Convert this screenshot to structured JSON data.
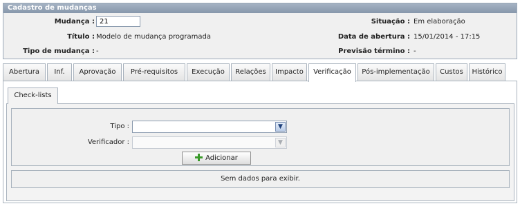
{
  "panel": {
    "title": "Cadastro de mudanças",
    "mudanca_label": "Mudança :",
    "mudanca_value": "21",
    "titulo_label": "Título :",
    "titulo_value": "Modelo de mudança programada",
    "tipo_label": "Tipo de mudança :",
    "tipo_value": "-",
    "situacao_label": "Situação :",
    "situacao_value": "Em elaboração",
    "abertura_label": "Data de abertura :",
    "abertura_value": "15/01/2014 - 17:15",
    "previsao_label": "Previsão término :",
    "previsao_value": "-"
  },
  "tabs": [
    {
      "label": "Abertura"
    },
    {
      "label": "Inf."
    },
    {
      "label": "Aprovação"
    },
    {
      "label": "Pré-requisitos"
    },
    {
      "label": "Execução"
    },
    {
      "label": "Relações"
    },
    {
      "label": "Impacto"
    },
    {
      "label": "Verificação"
    },
    {
      "label": "Pós-implementação"
    },
    {
      "label": "Custos"
    },
    {
      "label": "Histórico"
    }
  ],
  "active_tab": "Verificação",
  "subtab": {
    "label": "Check-lists"
  },
  "form": {
    "tipo_label": "Tipo :",
    "tipo_value": "",
    "verificador_label": "Verificador :",
    "verificador_value": "",
    "add_button": "Adicionar"
  },
  "empty_message": "Sem dados para exibir.",
  "icons": {
    "select_arrow": "chevron-down-icon",
    "add": "plus-icon"
  }
}
